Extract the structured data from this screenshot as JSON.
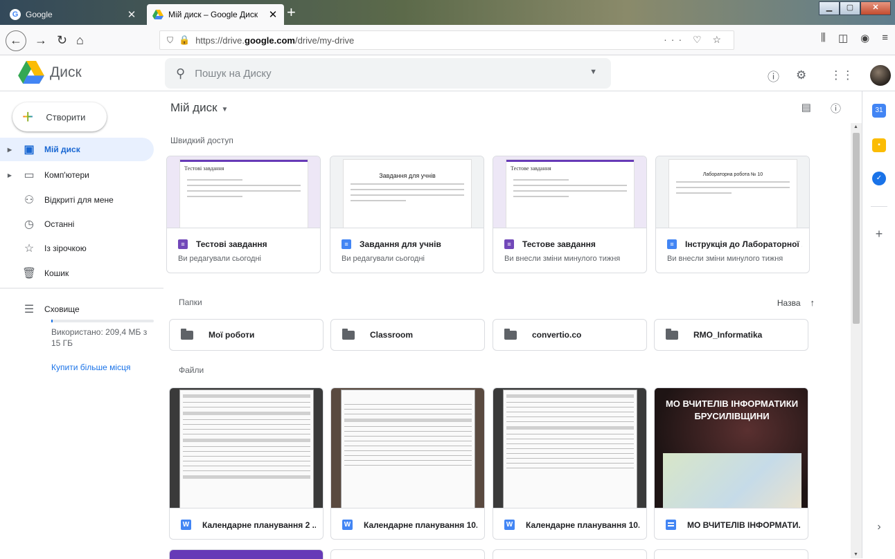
{
  "browser": {
    "tabs": [
      {
        "title": "Google",
        "icon": "google-icon"
      },
      {
        "title": "Мій диск – Google Диск",
        "icon": "google-drive-icon"
      }
    ],
    "new_tab": "+",
    "close_glyph": "✕",
    "url": "https://drive.google.com/drive/my-drive",
    "url_prefix": "https://drive.",
    "url_domain": "google.com",
    "url_path": "/drive/my-drive"
  },
  "header": {
    "app_name": "Диск",
    "search_placeholder": "Пошук на Диску"
  },
  "sidebar": {
    "create_label": "Створити",
    "items": [
      {
        "label": "Мій диск",
        "icon": "my-drive-icon",
        "active": true,
        "expandable": true
      },
      {
        "label": "Комп'ютери",
        "icon": "computers-icon",
        "active": false,
        "expandable": true
      },
      {
        "label": "Відкриті для мене",
        "icon": "shared-with-me-icon",
        "active": false,
        "expandable": false
      },
      {
        "label": "Останні",
        "icon": "recent-icon",
        "active": false,
        "expandable": false
      },
      {
        "label": "Із зірочкою",
        "icon": "starred-icon",
        "active": false,
        "expandable": false
      },
      {
        "label": "Кошик",
        "icon": "trash-icon",
        "active": false,
        "expandable": false
      }
    ],
    "storage_label": "Сховище",
    "storage_used": "Використано: 209,4 МБ з 15 ГБ",
    "storage_fraction": 0.014,
    "buy_storage": "Купити більше місця"
  },
  "main": {
    "title": "Мій диск",
    "quick_access_label": "Швидкий доступ",
    "quick_access": [
      {
        "name": "Тестові завдання",
        "type": "forms",
        "subtitle": "Ви редагували сьогодні",
        "preview_title": "Тестові завдання"
      },
      {
        "name": "Завдання для учнів",
        "type": "docs",
        "subtitle": "Ви редагували сьогодні",
        "preview_title": "Завдання для учнів"
      },
      {
        "name": "Тестове завдання",
        "type": "forms",
        "subtitle": "Ви внесли зміни минулого тижня",
        "preview_title": "Тестове завдання"
      },
      {
        "name": "Інструкція до Лабораторної ...",
        "type": "docs",
        "subtitle": "Ви внесли зміни минулого тижня",
        "preview_title": "Лабораторна робота № 10"
      }
    ],
    "folders_label": "Папки",
    "sort_label": "Назва",
    "folders": [
      "Мої роботи",
      "Classroom",
      "convertio.co",
      "RMO_Informatika"
    ],
    "files_label": "Файли",
    "files": [
      {
        "name": "Календарне планування 2 ...",
        "type": "word"
      },
      {
        "name": "Календарне планування 10...",
        "type": "word"
      },
      {
        "name": "Календарне планування 10...",
        "type": "word"
      },
      {
        "name": "МО ВЧИТЕЛІВ ІНФОРМАТИ...",
        "type": "slides",
        "preview_title": "МО ВЧИТЕЛІВ ІНФОРМАТИКИ БРУСИЛІВЩИНИ"
      }
    ]
  },
  "colors": {
    "accent": "#1a73e8",
    "active_bg": "#e8f0fe",
    "forms": "#7248b9",
    "docs": "#4285f4"
  }
}
